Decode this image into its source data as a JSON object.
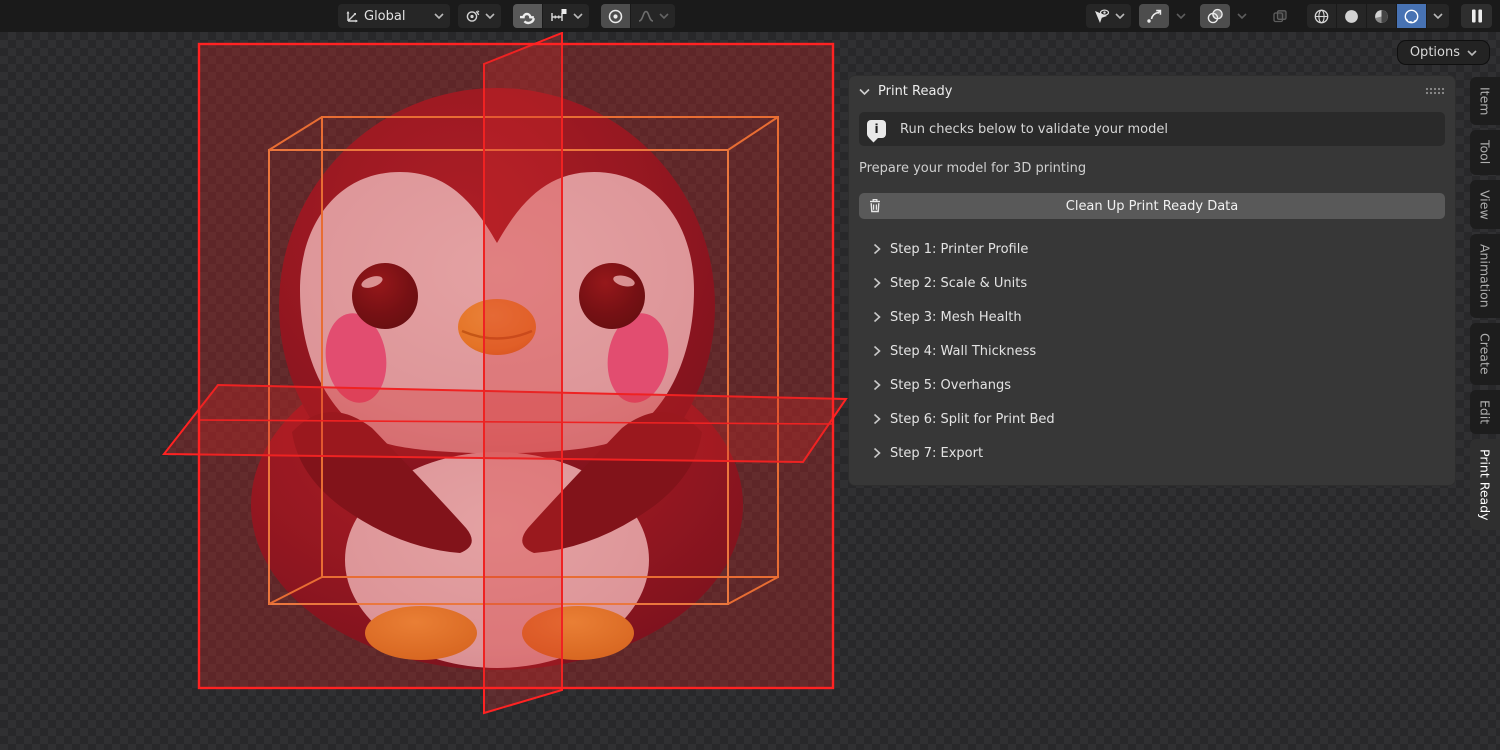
{
  "header": {
    "orientation_label": "Global",
    "options_label": "Options"
  },
  "panel": {
    "title": "Print Ready",
    "info_message": "Run checks below to validate your model",
    "description": "Prepare your model for 3D printing",
    "cleanup_button": "Clean Up Print Ready Data",
    "steps": [
      "Step 1: Printer Profile",
      "Step 2: Scale & Units",
      "Step 3: Mesh Health",
      "Step 4: Wall Thickness",
      "Step 5: Overhangs",
      "Step 6: Split for Print Bed",
      "Step 7: Export"
    ]
  },
  "tabs": {
    "items": [
      "Item",
      "Tool",
      "View",
      "Animation",
      "Create",
      "Edit",
      "Print Ready"
    ],
    "active": "Print Ready"
  },
  "viewport": {
    "model": "cute penguin figurine",
    "overlays": [
      "selection bounding box (orange wireframe)",
      "red cross-section planes"
    ]
  },
  "icons": {
    "transform-orientation": "axis arrows",
    "pivot-point": "circle with center dot",
    "snap-magnet": "magnet (enabled)",
    "snap-target": "increment snap",
    "proportional-editing": "circle with dot (enabled)",
    "falloff-curve": "bell curve (disabled)",
    "show-gizmo": "cursor with eye",
    "gizmos": "curved arrow",
    "overlays": "two circles",
    "xray": "overlapping squares (disabled)",
    "shading-wireframe": "wire sphere",
    "shading-solid": "solid sphere",
    "shading-material": "half sphere",
    "shading-rendered": "dashed sphere (active)",
    "pause": "two bars",
    "info": "speech bubble i",
    "trash": "trash can",
    "chevron-down": "⌄",
    "chevron-right": "❯"
  },
  "colors": {
    "accent_blue": "#4772b3",
    "overlay_red": "#ff2222",
    "wireframe_orange": "#f5913b",
    "panel_bg": "#373737",
    "header_bg": "#1a1a1a"
  }
}
